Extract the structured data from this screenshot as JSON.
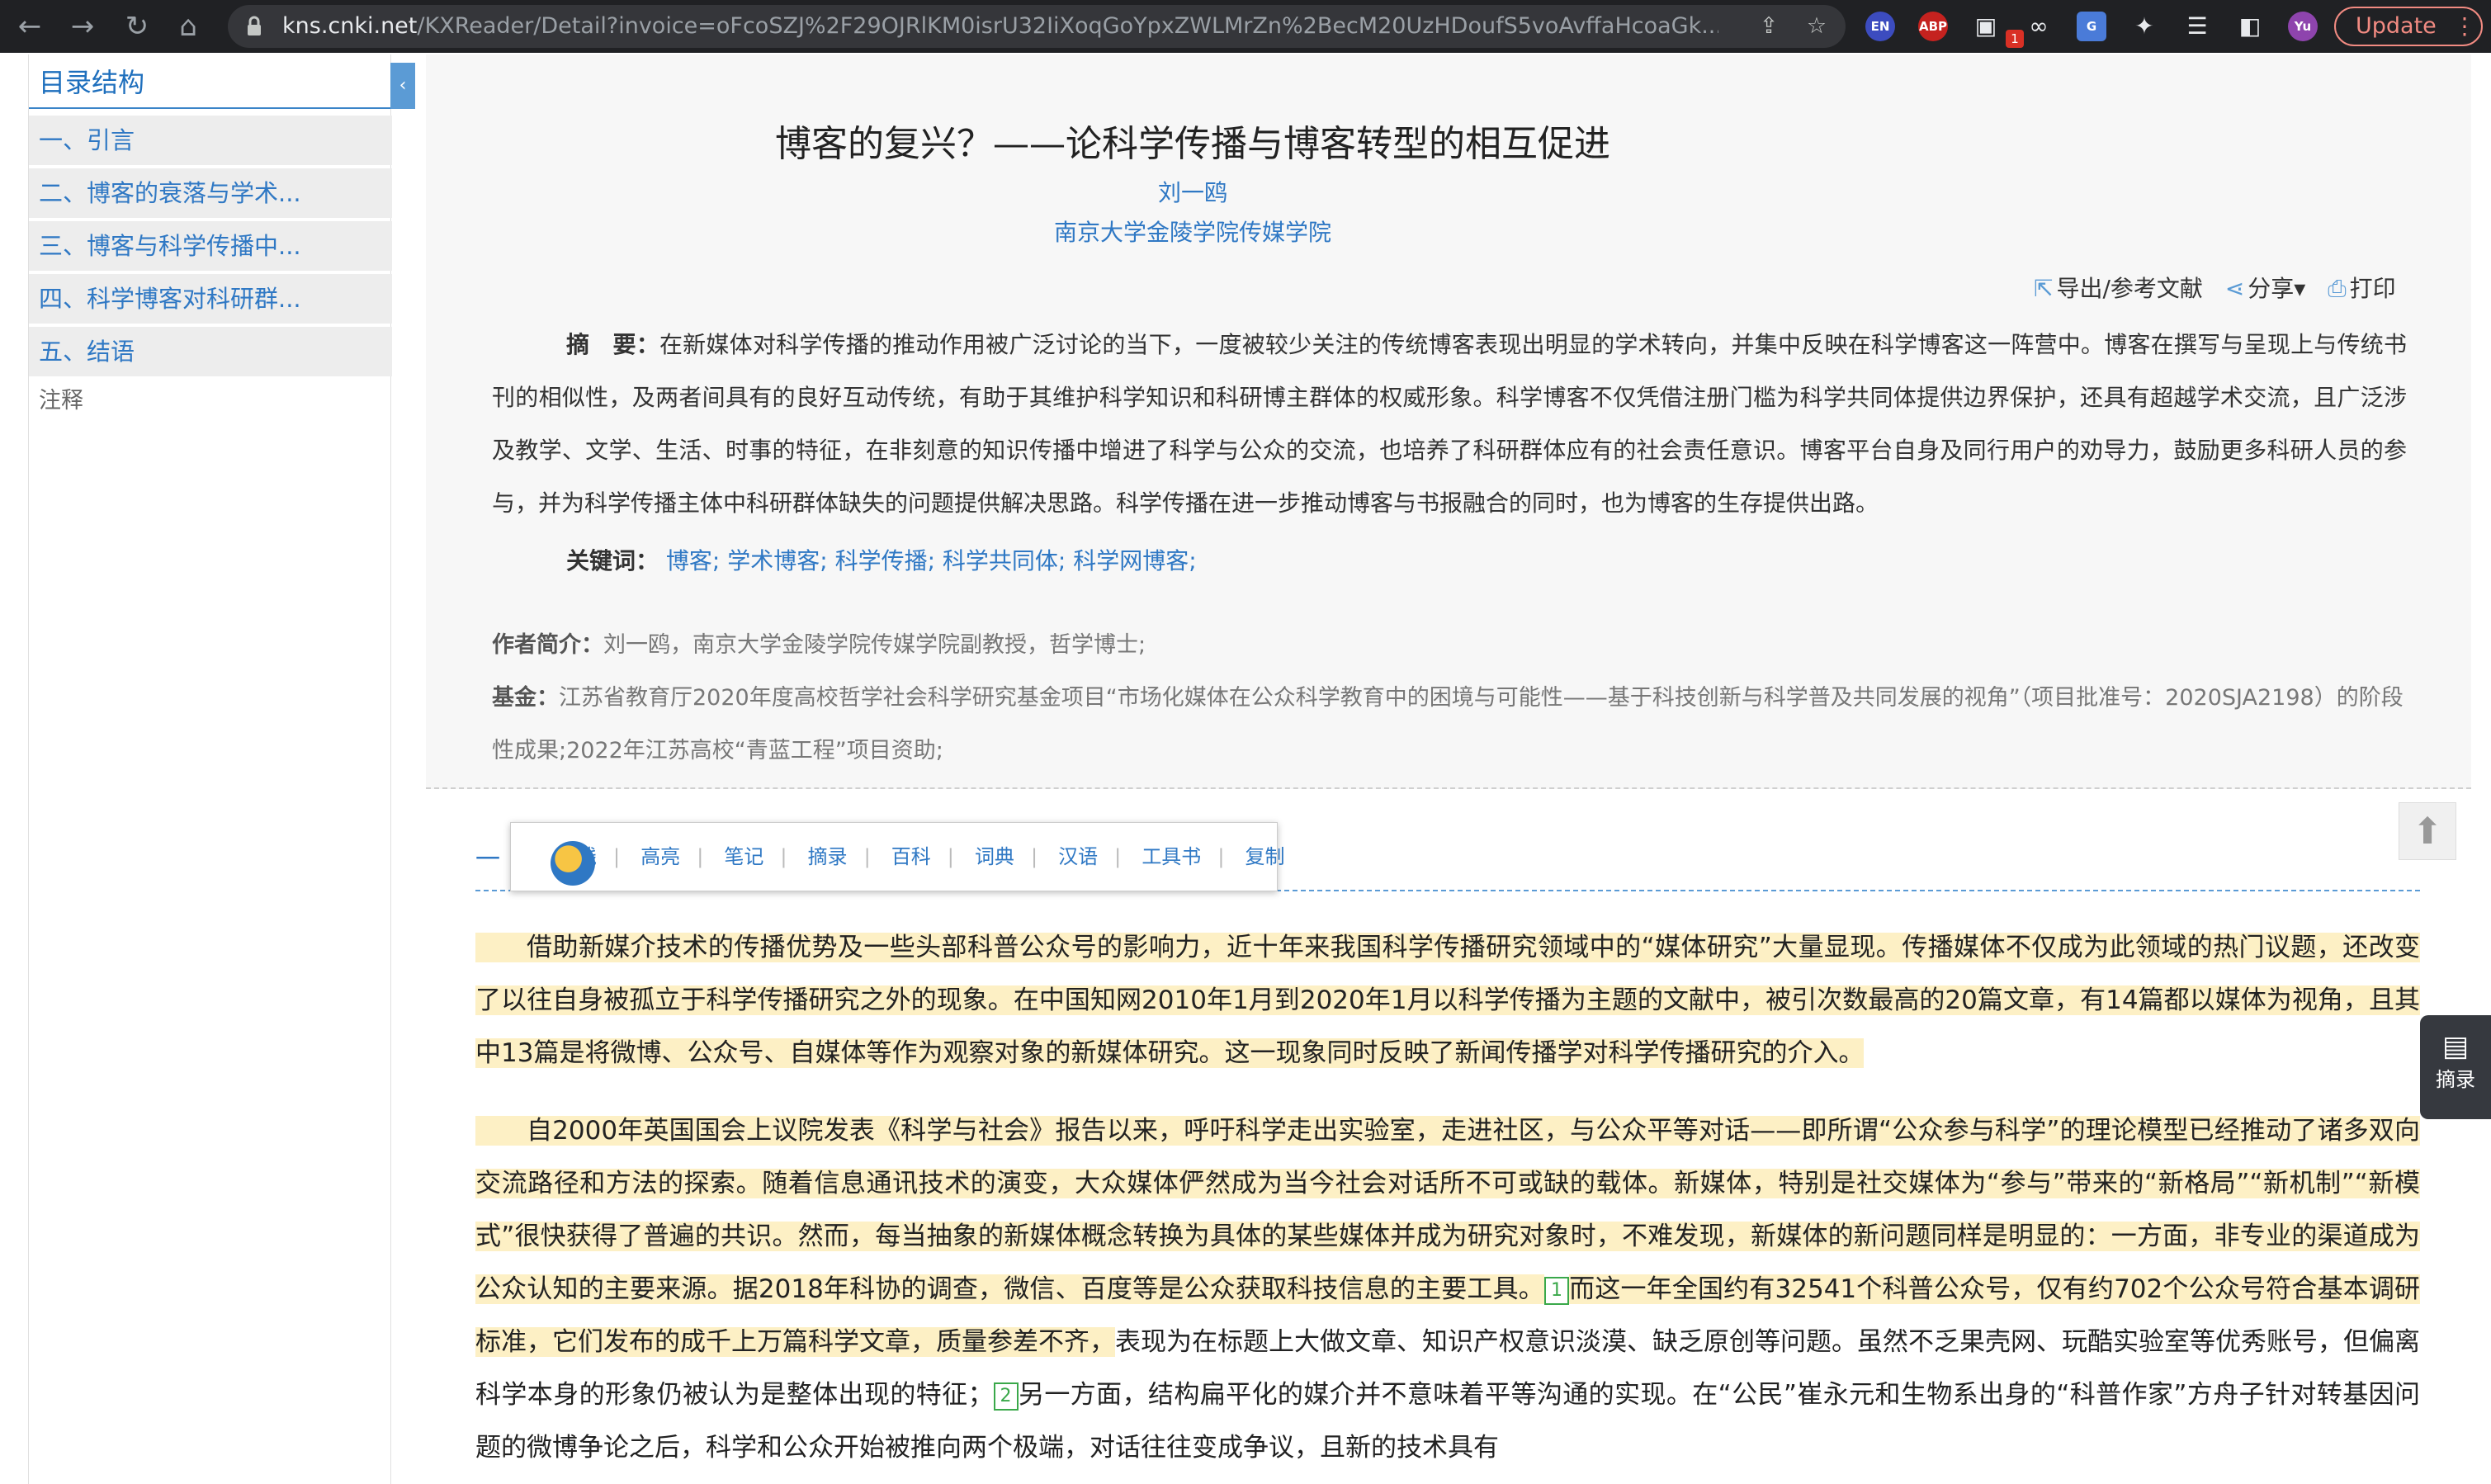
{
  "browser": {
    "url_host": "kns.cnki.net",
    "url_path": "/KXReader/Detail?invoice=oFcoSZJ%2F29OJRlKM0isrU32IiXoqGoYpxZWLMrZn%2BecM20UzHDoufS5voAvffaHcoaGk...",
    "extensions": [
      "EN",
      "ABP",
      "1"
    ],
    "profile": "Yu",
    "update_label": "Update"
  },
  "sidebar": {
    "title": "目录结构",
    "items": [
      {
        "label": "一、引言"
      },
      {
        "label": "二、博客的衰落与学术..."
      },
      {
        "label": "三、博客与科学传播中..."
      },
      {
        "label": "四、科学博客对科研群..."
      },
      {
        "label": "五、结语"
      }
    ],
    "notes_label": "注释"
  },
  "article": {
    "title": "博客的复兴？——论科学传播与博客转型的相互促进",
    "author": "刘一鸥",
    "affiliation": "南京大学金陵学院传媒学院",
    "tools": {
      "export": "导出/参考文献",
      "share": "分享",
      "print": "打印"
    },
    "abstract_label": "摘　要：",
    "abstract": "在新媒体对科学传播的推动作用被广泛讨论的当下，一度被较少关注的传统博客表现出明显的学术转向，并集中反映在科学博客这一阵营中。博客在撰写与呈现上与传统书刊的相似性，及两者间具有的良好互动传统，有助于其维护科学知识和科研博主群体的权威形象。科学博客不仅凭借注册门槛为科学共同体提供边界保护，还具有超越学术交流，且广泛涉及教学、文学、生活、时事的特征，在非刻意的知识传播中增进了科学与公众的交流，也培养了科研群体应有的社会责任意识。博客平台自身及同行用户的劝导力，鼓励更多科研人员的参与，并为科学传播主体中科研群体缺失的问题提供解决思路。科学传播在进一步推动博客与书报融合的同时，也为博客的生存提供出路。",
    "keywords_label": "关键词：",
    "keywords": "博客; 学术博客; 科学传播; 科学共同体; 科学网博客;",
    "author_intro_label": "作者简介：",
    "author_intro": "刘一鸥，南京大学金陵学院传媒学院副教授，哲学博士;",
    "fund_label": "基金：",
    "fund": "江苏省教育厅2020年度高校哲学社会科学研究基金项目“市场化媒体在公众科学教育中的困境与可能性——基于科技创新与科学普及共同发展的视角”（项目批准号：2020SJA2198）的阶段性成果;2022年江苏高校“青蓝工程”项目资助;",
    "section_heading": "一",
    "para1": "借助新媒介技术的传播优势及一些头部科普公众号的影响力，近十年来我国科学传播研究领域中的“媒体研究”大量显现。传播媒体不仅成为此领域的热门议题，还改变了以往自身被孤立于科学传播研究之外的现象。在中国知网2010年1月到2020年1月以科学传播为主题的文献中，被引次数最高的20篇文章，有14篇都以媒体为视角，且其中13篇是将微博、公众号、自媒体等作为观察对象的新媒体研究。这一现象同时反映了新闻传播学对科学传播研究的介入。",
    "para2_a": "自2000年英国国会上议院发表《科学与社会》报告以来，呼吁科学走出实验室，走进社区，与公众平等对话——即所谓“公众参与科学”的理论模型已经推动了诸多双向交流路径和方法的探索。随着信息通讯技术的演变，大众媒体俨然成为当今社会对话所不可或缺的载体。新媒体，特别是社交媒体为“参与”带来的“新格局”“新机制”“新模式”很快获得了普遍的共识。然而，每当抽象的新媒体概念转换为具体的某些媒体并成为研究对象时，不难发现，新媒体的新问题同样是明显的：一方面，非专业的渠道成为公众认知的主要来源。据2018年科协的调查，微信、百度等是公众获取科技信息的主要工具。",
    "fn1": "1",
    "para2_b": "而这一年全国约有32541个科普公众号，仅有约702个公众号符合基本调研标准，它们发布的成千上万篇科学文章，质量参差不齐，",
    "para2_c": "表现为在标题上大做文章、知识产权意识淡漠、缺乏原创等问题。虽然不乏果壳网、玩酷实验室等优秀账号，但偏离科学本身的形象仍被认为是整体出现的特征；",
    "fn2": "2",
    "para2_d": "另一方面，结构扁平化的媒介并不意味着平等沟通的实现。在“公民”崔永元和生物系出身的“科普作家”方舟子针对转基因问题的微博争论之后，科学和公众开始被推向两个极端，对话往往变成争议，且新的技术具有"
  },
  "popup": {
    "items": [
      "划线",
      "高亮",
      "笔记",
      "摘录",
      "百科",
      "词典",
      "汉语",
      "工具书",
      "复制"
    ]
  },
  "side_panel": {
    "label": "摘录"
  }
}
